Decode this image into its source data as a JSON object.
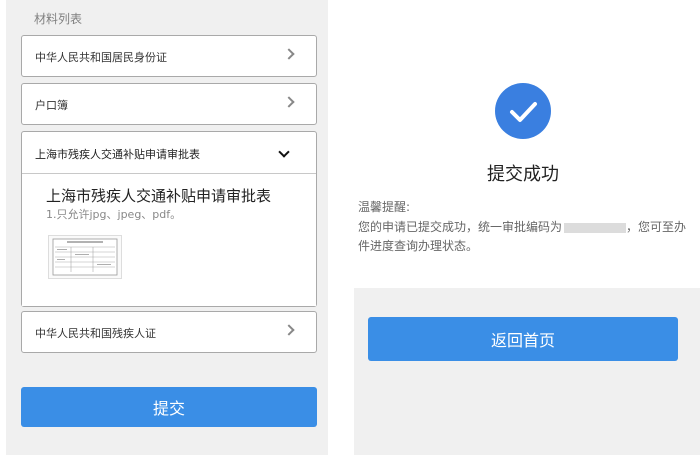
{
  "materials": {
    "section_label": "材料列表",
    "items": [
      {
        "label": "中华人民共和国居民身份证"
      },
      {
        "label": "户口簿"
      },
      {
        "label": "上海市残疾人交通补贴申请审批表"
      },
      {
        "label": "中华人民共和国残疾人证"
      }
    ],
    "expanded": {
      "title": "上海市残疾人交通补贴申请审批表",
      "note": "1.只允许jpg、jpeg、pdf。"
    }
  },
  "submit_label": "提交",
  "success": {
    "title": "提交成功",
    "tip_title": "温馨提醒:",
    "tip_body_before": "您的申请已提交成功，统一审批编码为",
    "tip_body_after": "，您可至办件进度查询办理状态。",
    "home_button": "返回首页"
  },
  "colors": {
    "accent": "#3a8ee6",
    "check": "#3a7fe0"
  },
  "icons": [
    "chevron-right-icon",
    "chevron-down-icon",
    "check-circle-icon"
  ]
}
